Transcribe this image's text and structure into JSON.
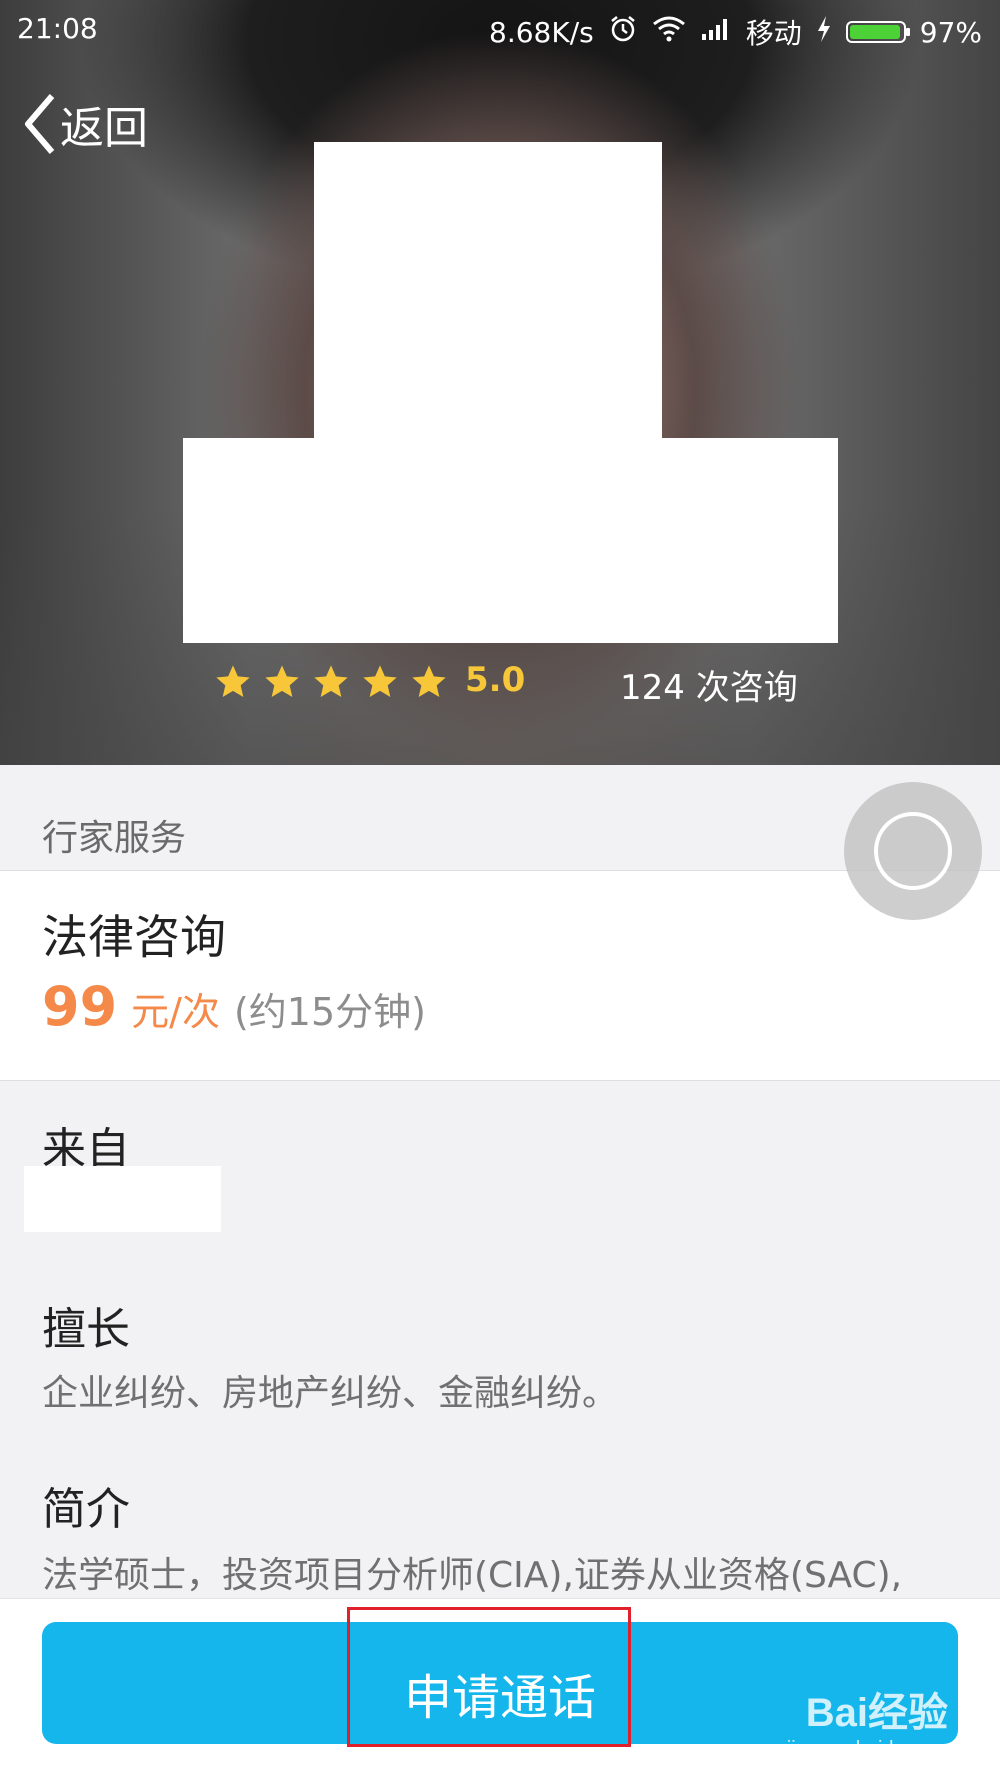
{
  "status_bar": {
    "time": "21:08",
    "net_speed": "8.68K/s",
    "carrier": "移动",
    "battery_text": "97%",
    "battery_level": 0.97,
    "battery_color": "#4cd137",
    "icons": [
      "alarm-icon",
      "wifi-icon",
      "signal-icon",
      "charging-icon",
      "battery-icon"
    ]
  },
  "nav": {
    "back_label": "返回"
  },
  "profile": {
    "rating_stars": 5,
    "rating_score": "5.0",
    "consult_count": "124 次咨询",
    "star_color": "#f7c739"
  },
  "service": {
    "section_label": "行家服务",
    "name": "法律咨询",
    "price": "99",
    "unit": "元/次",
    "duration": "(约15分钟)",
    "accent_color": "#f4894a"
  },
  "details": {
    "from_title": "来自",
    "expertise_title": "擅长",
    "expertise_text": "企业纠纷、房地产纠纷、金融纠纷。",
    "intro_title": "简介",
    "intro_text": "法学硕士，投资项目分析师(CIA),证券从业资格(SAC),"
  },
  "action": {
    "call_label": "申请通话",
    "button_color": "#14b6ec"
  },
  "watermark": {
    "logo": "Bai经验",
    "url": "jingyan.baidu.com"
  }
}
